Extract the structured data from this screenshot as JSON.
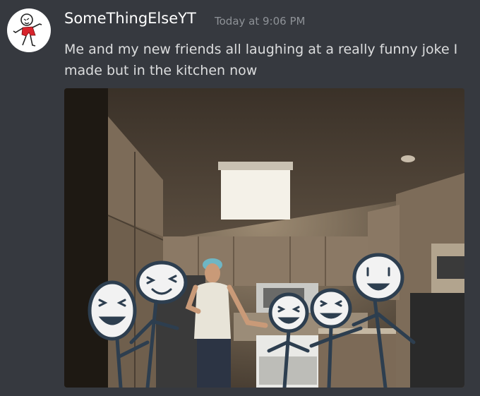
{
  "message": {
    "author": "SomeThingElseYT",
    "timestamp": "Today at 9:06 PM",
    "text": "Me and my new friends all laughing at a really funny joke I made but in the kitchen now",
    "avatar_icon": "stick-figure-avatar-icon",
    "attachment": {
      "subject": "kitchen-photo-with-stick-figures"
    }
  },
  "colors": {
    "background": "#36393f",
    "username": "#ffffff",
    "timestamp": "#8e9297",
    "message_text": "#dcddde"
  }
}
